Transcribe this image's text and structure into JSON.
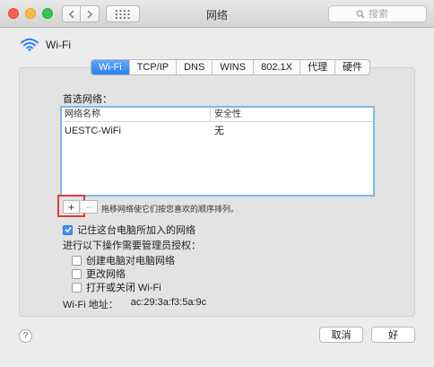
{
  "window": {
    "title": "网络"
  },
  "toolbar": {
    "search_placeholder": "搜索"
  },
  "header": {
    "label": "Wi-Fi",
    "icon": "wifi-icon"
  },
  "tabs": [
    {
      "label": "Wi-Fi",
      "active": true
    },
    {
      "label": "TCP/IP"
    },
    {
      "label": "DNS"
    },
    {
      "label": "WINS"
    },
    {
      "label": "802.1X"
    },
    {
      "label": "代理"
    },
    {
      "label": "硬件"
    }
  ],
  "preferred": {
    "label": "首选网络：",
    "columns": [
      "网络名称",
      "安全性"
    ],
    "rows": [
      {
        "name": "UESTC-WiFi",
        "security": "无"
      }
    ]
  },
  "list_controls": {
    "add": "+",
    "remove": "−",
    "hint": "拖移网络使它们按您喜欢的顺序排列。"
  },
  "remember": {
    "label": "记住这台电脑所加入的网络",
    "checked": true
  },
  "admin": {
    "label": "进行以下操作需要管理员授权：",
    "options": [
      {
        "label": "创建电脑对电脑网络",
        "checked": false
      },
      {
        "label": "更改网络",
        "checked": false
      },
      {
        "label": "打开或关闭 Wi-Fi",
        "checked": false
      }
    ]
  },
  "address": {
    "label": "Wi-Fi 地址：",
    "value": "ac:29:3a:f3:5a:9c"
  },
  "footer": {
    "help": "?",
    "cancel": "取消",
    "ok": "好"
  },
  "colors": {
    "accent": "#2b7ff2",
    "highlight_box": "#e03b3b"
  }
}
